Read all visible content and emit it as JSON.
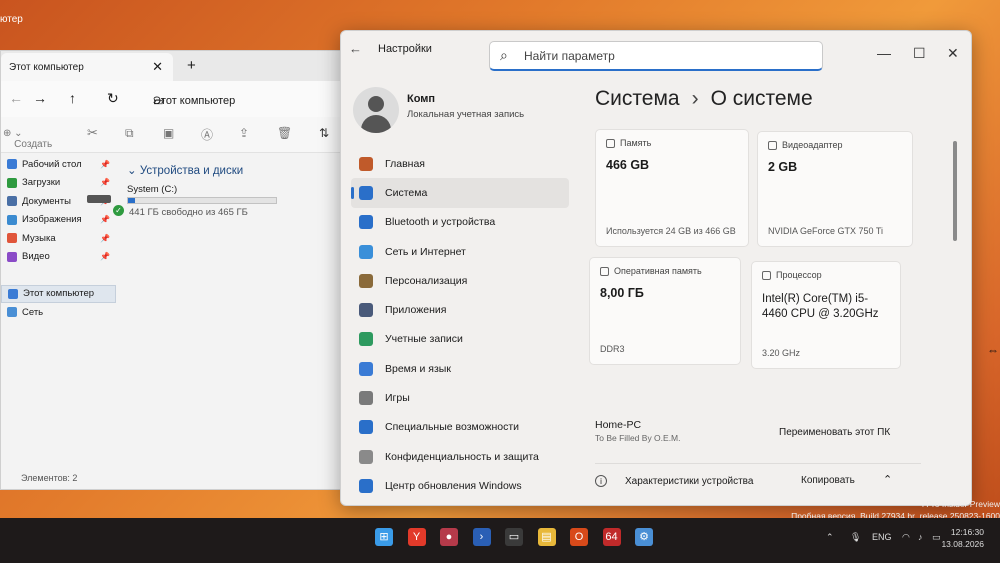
{
  "desktop": {
    "top_label": "ютер",
    "watermark_line1": "l Pro Insider Preview",
    "watermark_line2": "Пробная версия. Build 27934.br_release.250823-1600"
  },
  "explorer": {
    "tab_title": "Этот компьютер",
    "address": "Этот компьютер",
    "create_label": "Создать",
    "sidebar": [
      {
        "label": "Рабочий стол",
        "color": "#3a7bd5",
        "pinned": true
      },
      {
        "label": "Загрузки",
        "color": "#2e9a3f",
        "pinned": true
      },
      {
        "label": "Документы",
        "color": "#4a6fa5",
        "pinned": true
      },
      {
        "label": "Изображения",
        "color": "#3b8bd0",
        "pinned": true
      },
      {
        "label": "Музыка",
        "color": "#e0553a",
        "pinned": true
      },
      {
        "label": "Видео",
        "color": "#8a4bc7",
        "pinned": true
      },
      {
        "label": "",
        "color": "",
        "pinned": false
      },
      {
        "label": "Этот компьютер",
        "color": "#3a7bd5",
        "pinned": false
      },
      {
        "label": "Сеть",
        "color": "#4a8fd5",
        "pinned": false
      }
    ],
    "section_title": "Устройства и диски",
    "drive": {
      "name": "System (C:)",
      "free": "441 ГБ свободно из 465 ГБ",
      "used_fraction": 0.05
    },
    "status": "Элементов: 2"
  },
  "settings": {
    "app_title": "Настройки",
    "search_placeholder": "Найти параметр",
    "user": {
      "name": "Комп",
      "account_type": "Локальная учетная запись"
    },
    "nav": [
      {
        "label": "Главная",
        "color": "#c05a2a"
      },
      {
        "label": "Система",
        "color": "#2a6fc9",
        "active": true
      },
      {
        "label": "Bluetooth и устройства",
        "color": "#2a6fc9"
      },
      {
        "label": "Сеть и Интернет",
        "color": "#3a8fd9"
      },
      {
        "label": "Персонализация",
        "color": "#8a6a3a"
      },
      {
        "label": "Приложения",
        "color": "#4a5a7a"
      },
      {
        "label": "Учетные записи",
        "color": "#2e9a5f"
      },
      {
        "label": "Время и язык",
        "color": "#3a7bd5"
      },
      {
        "label": "Игры",
        "color": "#7a7a7a"
      },
      {
        "label": "Специальные возможности",
        "color": "#2a6fc9"
      },
      {
        "label": "Конфиденциальность и защита",
        "color": "#8a8a8a"
      },
      {
        "label": "Центр обновления Windows",
        "color": "#2a6fc9"
      }
    ],
    "breadcrumb": {
      "parent": "Система",
      "separator": "›",
      "current": "О системе"
    },
    "cards": {
      "storage": {
        "label": "Память",
        "value": "466 GB",
        "detail": "Используется 24 GB из 466 GB"
      },
      "gpu": {
        "label": "Видеоадаптер",
        "value": "2 GB",
        "detail": "NVIDIA GeForce GTX 750 Ti"
      },
      "ram": {
        "label": "Оперативная память",
        "value": "8,00 ГБ",
        "detail": "DDR3"
      },
      "cpu": {
        "label": "Процессор",
        "value": "Intel(R) Core(TM) i5-4460  CPU @ 3.20GHz",
        "detail": "3.20 GHz"
      }
    },
    "device_name": "Home-PC",
    "oem": "To Be Filled By O.E.M.",
    "rename_button": "Переименовать этот ПК",
    "specs_label": "Характеристики устройства",
    "copy_button": "Копировать"
  },
  "taskbar": {
    "icons": [
      {
        "name": "windows-start-icon",
        "glyph": "⊞",
        "color": "#3a9be8"
      },
      {
        "name": "yandex-browser-icon",
        "glyph": "Y",
        "color": "#e23a2a"
      },
      {
        "name": "media-app-icon",
        "glyph": "●",
        "color": "#b53a4a"
      },
      {
        "name": "powershell-icon",
        "glyph": "›",
        "color": "#2a5fb5"
      },
      {
        "name": "terminal-icon",
        "glyph": "▭",
        "color": "#3a3a3a"
      },
      {
        "name": "file-explorer-icon",
        "glyph": "▤",
        "color": "#e8b83a"
      },
      {
        "name": "office-icon",
        "glyph": "O",
        "color": "#d84a1a"
      },
      {
        "name": "aida64-icon",
        "glyph": "64",
        "color": "#c02a2a"
      },
      {
        "name": "settings-gear-icon",
        "glyph": "⚙",
        "color": "#4a8fd5"
      }
    ],
    "lang": "ENG",
    "time": "12:16:30",
    "date": "13.08.2026"
  }
}
